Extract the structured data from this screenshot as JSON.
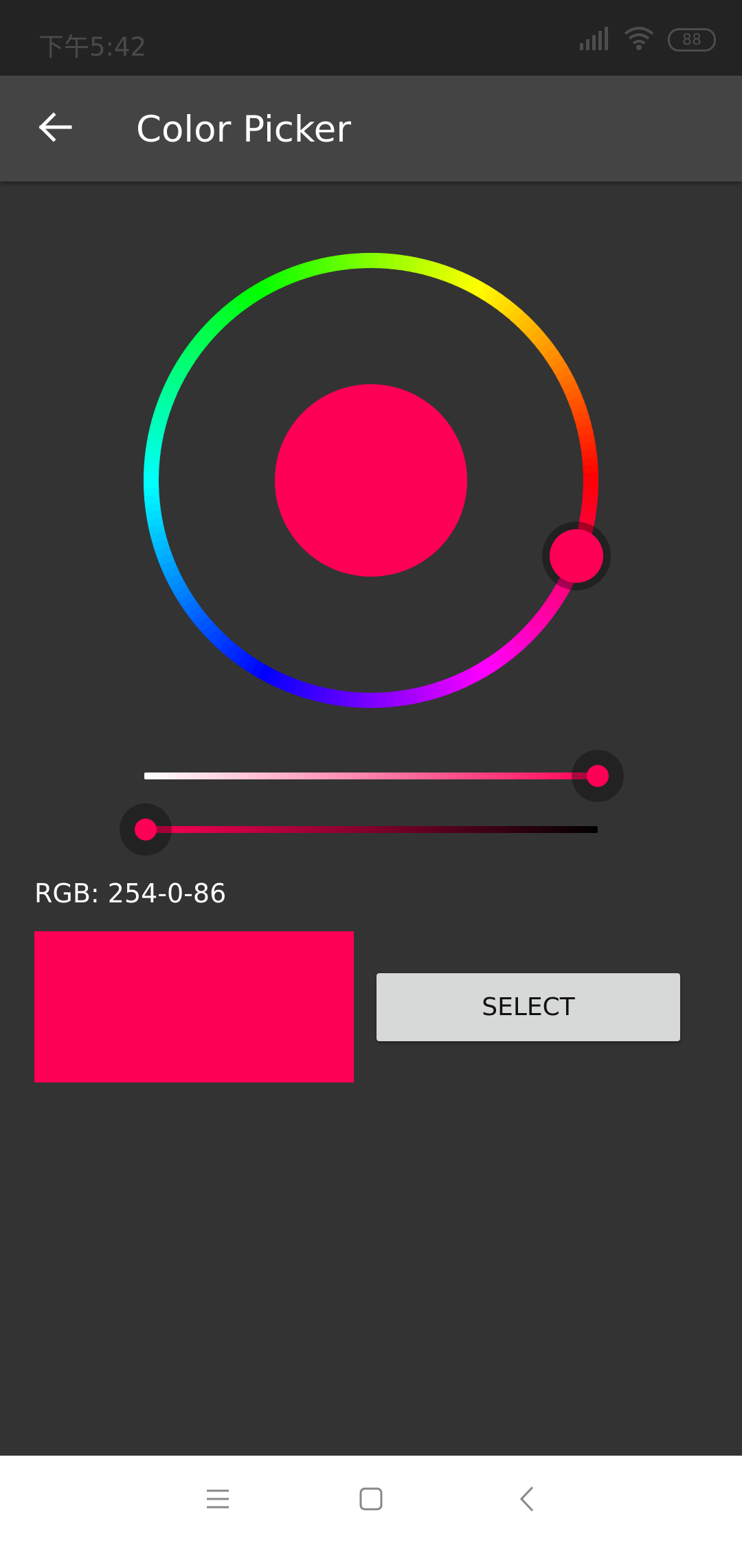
{
  "status_bar": {
    "time": "下午5:42",
    "battery": "88",
    "icons": [
      "signal-icon",
      "wifi-icon",
      "battery-icon"
    ]
  },
  "app_bar": {
    "title": "Color Picker",
    "back_icon": "arrow-left-icon"
  },
  "picker": {
    "selected_color": "#FE0056",
    "hue_degrees": 340,
    "saturation_slider_value": 1.0,
    "value_slider_value": 1.0
  },
  "rgb": {
    "label": "RGB: 254-0-86"
  },
  "actions": {
    "select_label": "SELECT"
  },
  "nav_bar": {
    "icons": [
      "menu-icon",
      "home-icon",
      "back-icon"
    ]
  },
  "colors": {
    "background": "#333333",
    "app_bar": "#444444",
    "status_bar": "#232323",
    "button": "#D7D8D8"
  }
}
